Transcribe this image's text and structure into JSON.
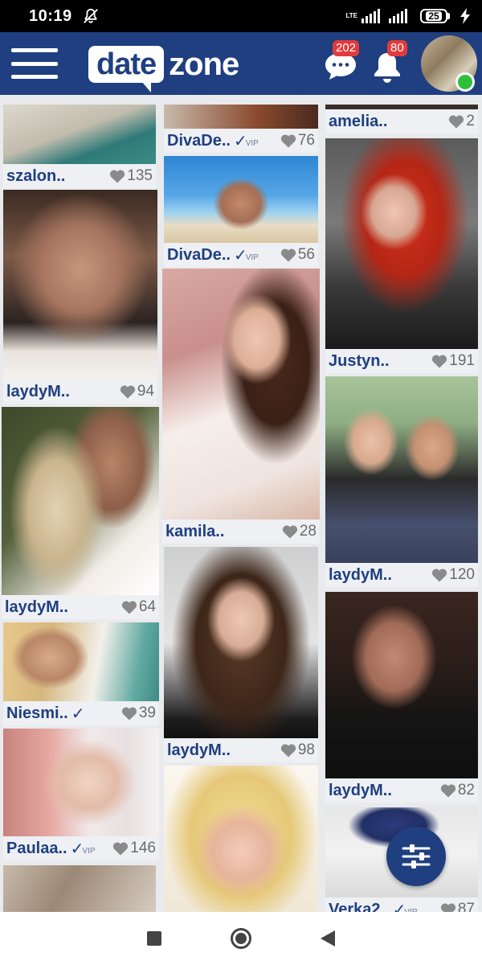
{
  "status_bar": {
    "time": "10:19",
    "network": "LTE",
    "battery": "25"
  },
  "header": {
    "logo_left": "date",
    "logo_right": "zone",
    "messages_count": "202",
    "notifications_count": "80"
  },
  "colors": {
    "brand": "#1f3f80",
    "badge": "#e23b3b",
    "online": "#2fbf3a"
  },
  "profiles": [
    {
      "name": "szalon..",
      "likes": "135",
      "verified": false,
      "vip": false
    },
    {
      "name": "laydyM..",
      "likes": "94",
      "verified": false,
      "vip": false
    },
    {
      "name": "laydyM..",
      "likes": "64",
      "verified": false,
      "vip": false
    },
    {
      "name": "Niesmi..",
      "likes": "39",
      "verified": true,
      "vip": false
    },
    {
      "name": "Paulaa..",
      "likes": "146",
      "verified": true,
      "vip": true
    },
    {
      "name": "DivaDe..",
      "likes": "76",
      "verified": true,
      "vip": true
    },
    {
      "name": "DivaDe..",
      "likes": "56",
      "verified": true,
      "vip": true
    },
    {
      "name": "kamila..",
      "likes": "28",
      "verified": false,
      "vip": false
    },
    {
      "name": "laydyM..",
      "likes": "98",
      "verified": false,
      "vip": false
    },
    {
      "name": "amelia..",
      "likes": "2",
      "verified": false,
      "vip": false
    },
    {
      "name": "Justyn..",
      "likes": "191",
      "verified": false,
      "vip": false
    },
    {
      "name": "laydyM..",
      "likes": "120",
      "verified": false,
      "vip": false
    },
    {
      "name": "laydyM..",
      "likes": "82",
      "verified": false,
      "vip": false
    },
    {
      "name": "Verka2..",
      "likes": "87",
      "verified": true,
      "vip": true
    }
  ],
  "labels": {
    "check": "✓",
    "vip": "VIP"
  }
}
